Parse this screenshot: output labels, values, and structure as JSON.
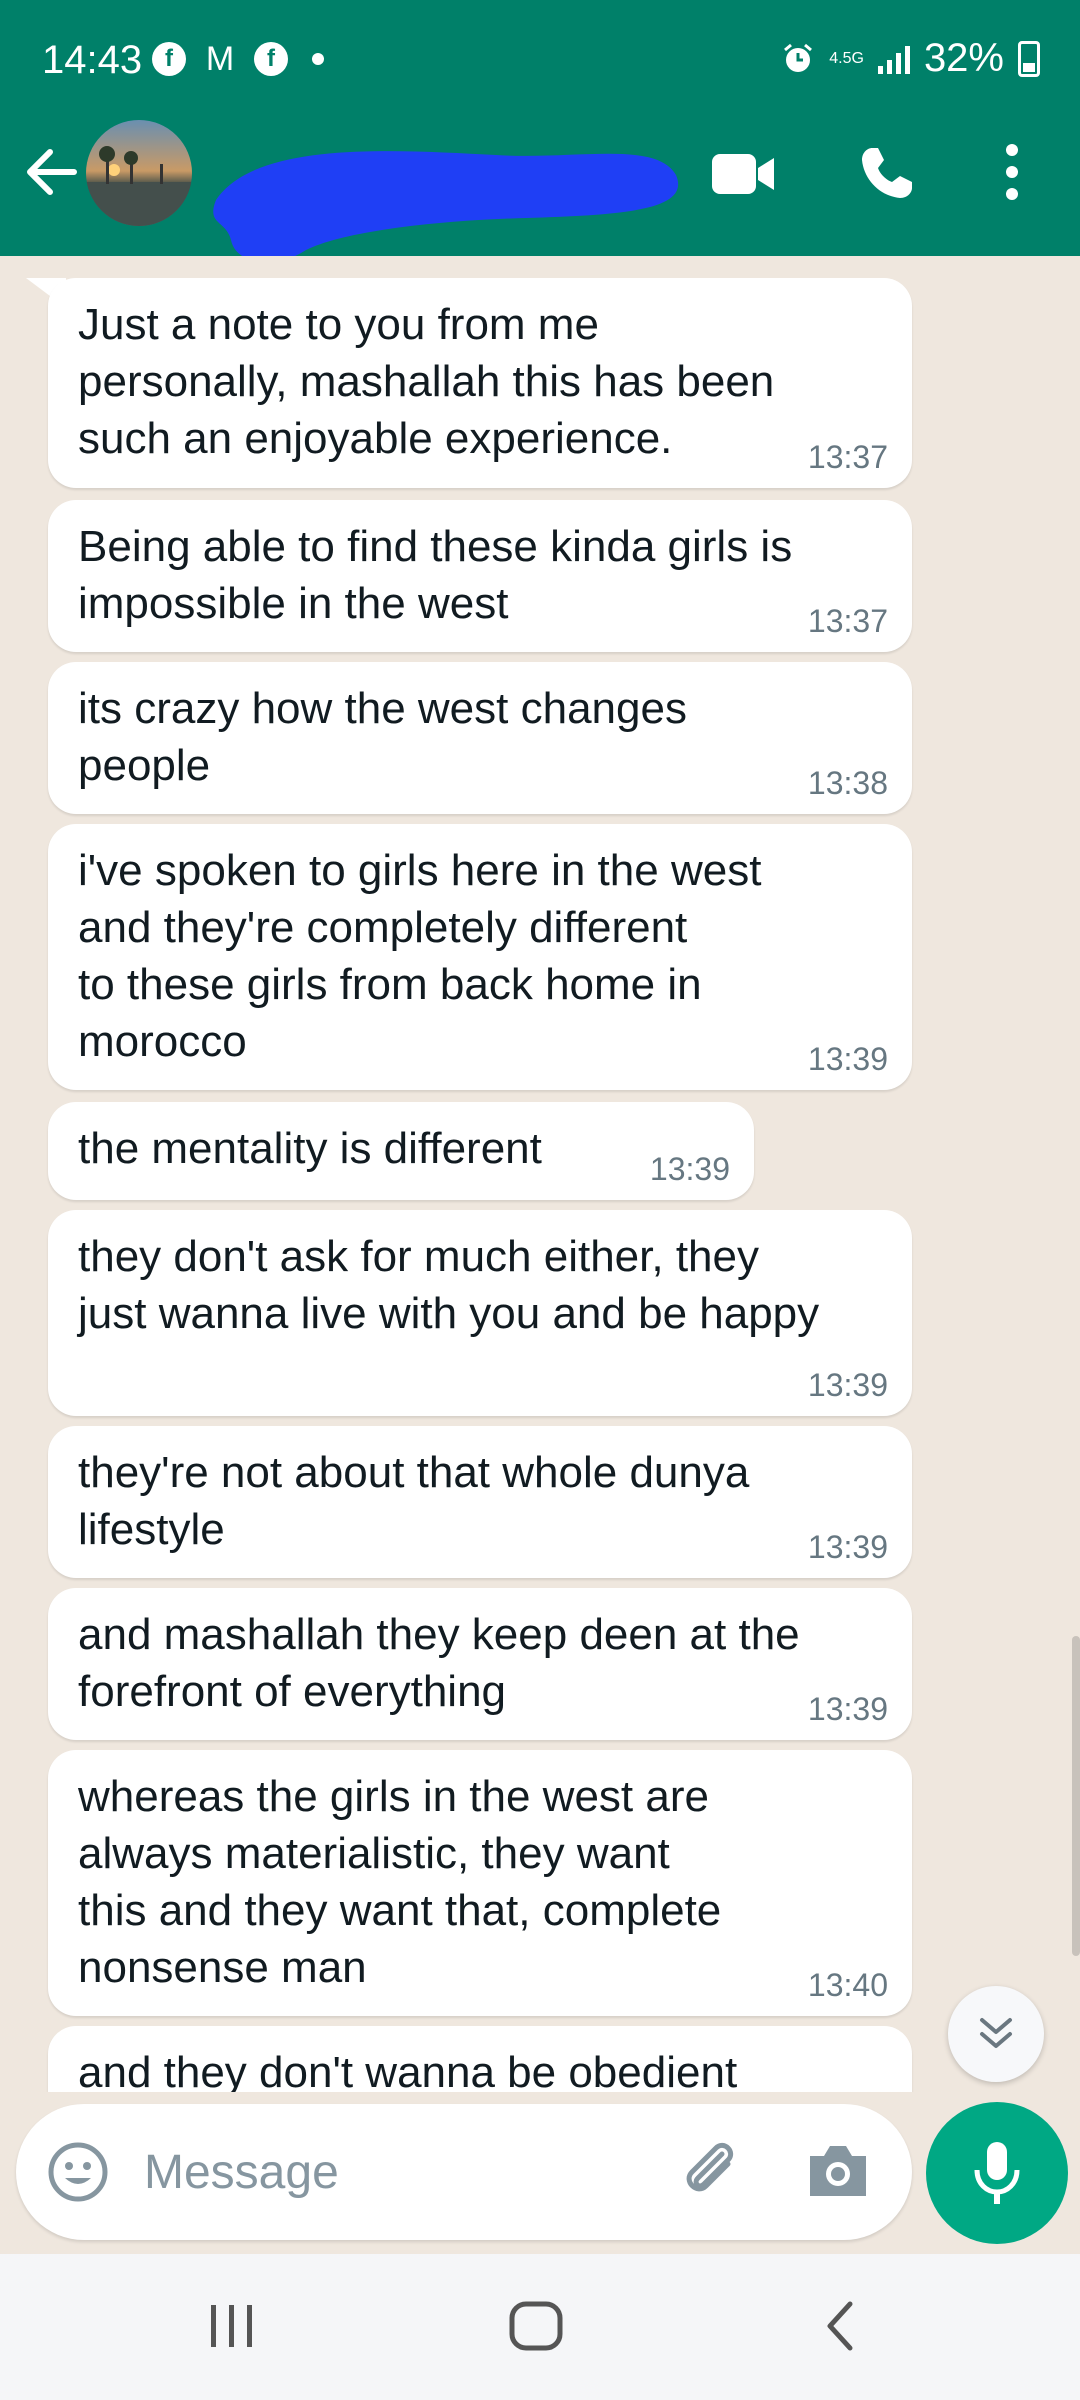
{
  "status_bar": {
    "time": "14:43",
    "network": "4.5G",
    "battery": "32%",
    "notification_icons": [
      "facebook-icon",
      "gmail-icon",
      "facebook-icon"
    ]
  },
  "header": {
    "contact_name": "",
    "actions": [
      "video-call-icon",
      "voice-call-icon",
      "more-options-icon"
    ]
  },
  "messages": [
    {
      "text": "Just a note to you from me\npersonally, mashallah this has been\nsuch an enjoyable experience.",
      "time": "13:37"
    },
    {
      "text": "Being able to find these kinda girls is\nimpossible in the west",
      "time": "13:37"
    },
    {
      "text": "its crazy how the west changes\npeople",
      "time": "13:38"
    },
    {
      "text": "i've spoken to girls here in the west\nand they're completely different\nto these girls from back home in\nmorocco",
      "time": "13:39"
    },
    {
      "text": "the mentality is different",
      "time": "13:39"
    },
    {
      "text": "they don't ask for much either, they\njust wanna live with you and be happy",
      "time": "13:39"
    },
    {
      "text": "they're not about that whole dunya\nlifestyle",
      "time": "13:39"
    },
    {
      "text": "and mashallah they keep deen at the\nforefront of everything",
      "time": "13:39"
    },
    {
      "text": "whereas the girls in the west are\nalways materialistic, they want\nthis and they want that, complete\nnonsense man",
      "time": "13:40"
    },
    {
      "text": "and they don't wanna be obedient",
      "time": ""
    }
  ],
  "composer": {
    "placeholder": "Message"
  },
  "colors": {
    "header": "#008069",
    "chat_background": "#efe7de",
    "bubble": "#ffffff",
    "mic_button": "#00a884",
    "scribble": "#1f3ff5"
  }
}
